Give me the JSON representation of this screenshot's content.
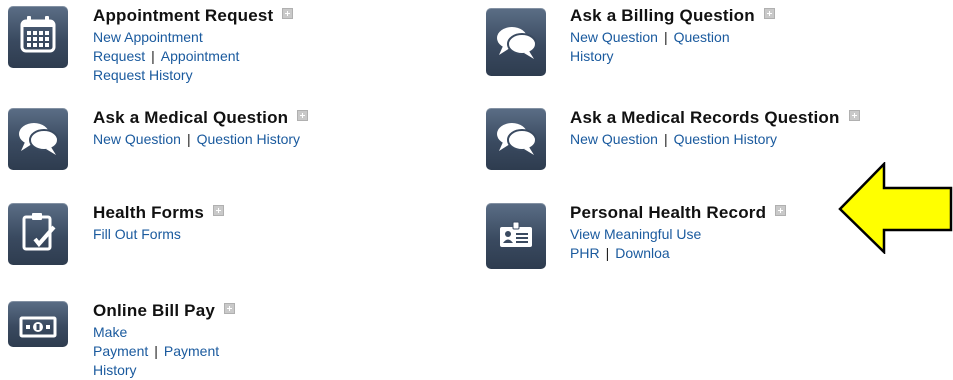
{
  "toggle_symbol": "+",
  "cards": {
    "appointment": {
      "title": "Appointment Request",
      "link1": "New Appointment Request",
      "link2_line1": "Appointment",
      "link2_line2": "Request History",
      "icon": "calendar-icon"
    },
    "billing": {
      "title": "Ask a Billing Question",
      "link1": "New Question",
      "link2": "Question History",
      "icon": "speech-bubbles-icon"
    },
    "medical": {
      "title": "Ask a Medical Question",
      "link1": "New Question",
      "link2": "Question History",
      "icon": "speech-bubbles-icon"
    },
    "records": {
      "title": "Ask a Medical Records Question",
      "link1": "New Question",
      "link2": "Question History",
      "icon": "speech-bubbles-icon"
    },
    "forms": {
      "title": "Health Forms",
      "link1": "Fill Out Forms",
      "icon": "clipboard-check-icon"
    },
    "phr": {
      "title": "Personal Health Record",
      "link1": "View Meaningful Use PHR",
      "link2": "Downloa",
      "icon": "id-badge-icon"
    },
    "billpay": {
      "title": "Online Bill Pay",
      "link1": "Make Payment",
      "link2": "Payment History",
      "icon": "cash-icon"
    }
  },
  "colors": {
    "link": "#1a5a9e",
    "tile": "#3a4a60",
    "arrow_fill": "#ffff00"
  }
}
